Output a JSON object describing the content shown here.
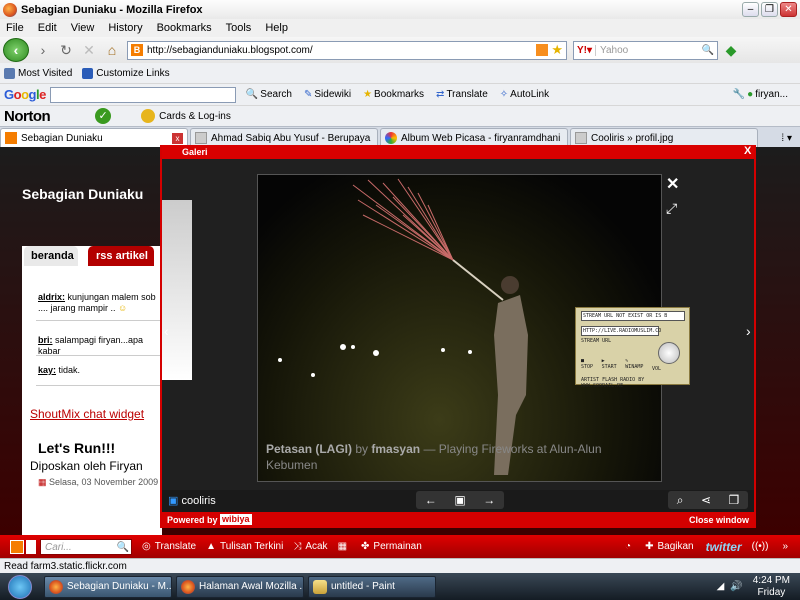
{
  "window": {
    "title": "Sebagian Duniaku - Mozilla Firefox"
  },
  "menu": [
    "File",
    "Edit",
    "View",
    "History",
    "Bookmarks",
    "Tools",
    "Help"
  ],
  "nav": {
    "url": "http://sebagianduniaku.blogspot.com/",
    "search_placeholder": "Yahoo"
  },
  "bookmarks": [
    "Most Visited",
    "Customize Links"
  ],
  "google_bar": {
    "logo": "Google",
    "items": [
      "Search",
      "Sidewiki",
      "Bookmarks",
      "Translate",
      "AutoLink",
      "firyan..."
    ]
  },
  "norton": {
    "logo": "Norton",
    "cards": "Cards & Log-ins"
  },
  "tabs": [
    {
      "label": "Sebagian Duniaku",
      "active": true
    },
    {
      "label": "Ahmad Sabiq Abu Yusuf - Berupaya M...",
      "active": false
    },
    {
      "label": "Album Web Picasa - firyanramdhani - ...",
      "active": false
    },
    {
      "label": "Cooliris » profil.jpg",
      "active": false
    }
  ],
  "blog": {
    "title": "Sebagian Duniaku",
    "tab_home": "beranda",
    "tab_rss": "rss artikel",
    "comments": [
      {
        "user": "aldrix:",
        "text": "kunjungan malem sob .... jarang mampir .."
      },
      {
        "user": "bri:",
        "text": "salampagi firyan...apa kabar"
      },
      {
        "user": "kay:",
        "text": "tidak."
      }
    ],
    "shoutmix": "ShoutMix chat widget",
    "post_title": "Let's Run!!!",
    "posted_by": "Diposkan oleh Firyan",
    "date": "Selasa, 03 November 2009"
  },
  "lightbox": {
    "header": "Galeri",
    "close": "X",
    "caption_title": "Petasan (LAGI)",
    "caption_by": "by",
    "caption_user": "fmasyan",
    "caption_rest": "— Playing Fireworks at Alun-Alun Kebumen",
    "brand": "cooliris",
    "powered": "Powered by",
    "powered_brand": "wibiya",
    "close_window": "Close window"
  },
  "radio": {
    "line1": "STREAM URL NOT EXIST OR IS B",
    "line2": "HTTP://LIVE.RADIOMUSLIM.CO",
    "label": "STREAM URL",
    "controls": [
      "STOP",
      "START",
      "WINAMP",
      "VOL"
    ],
    "footer": "ARTIST FLASH RADIO BY WWW.SOORAIL.RE"
  },
  "wibiya_bar": {
    "search_placeholder": "Cari...",
    "items": [
      "Translate",
      "Tulisan Terkini",
      "Acak",
      "Permainan",
      "Bagikan"
    ],
    "twitter": "twitter"
  },
  "status": "Read farm3.static.flickr.com",
  "taskbar": {
    "tasks": [
      "Sebagian Duniaku - M...",
      "Halaman Awal Mozilla ...",
      "untitled - Paint"
    ],
    "time": "4:24 PM",
    "day": "Friday"
  }
}
